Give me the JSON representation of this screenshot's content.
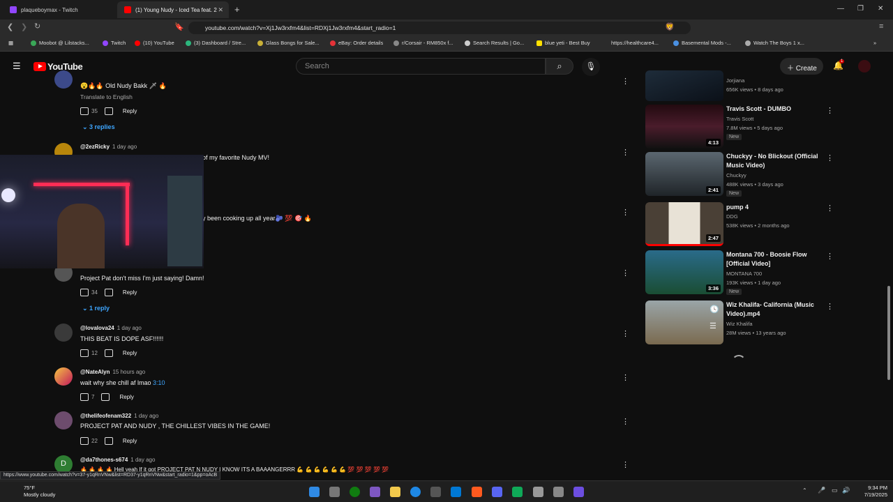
{
  "browser": {
    "tabs": [
      {
        "title": "plaqueboymax - Twitch"
      },
      {
        "title": "(1) Young Nudy - Iced Tea feat. 2"
      }
    ],
    "url": "youtube.com/watch?v=Xj1Jw3rxfm4&list=RDXj1Jw3rxfm4&start_radio=1",
    "bookmarks": [
      "Moobot @ Lilstacks...",
      "Twitch",
      "(10) YouTube",
      "(3) Dashboard / Stre...",
      "Glass Bongs for Sale...",
      "eBay: Order details",
      "r/Corsair - RM850x f...",
      "Search Results | Go...",
      "blue yeti - Best Buy",
      "https://healthcare4...",
      "Basemental Mods -...",
      "Watch The Boys 1 x..."
    ]
  },
  "youtube": {
    "logo": "YouTube",
    "search_placeholder": "Search",
    "create_label": "Create",
    "notif_count": "1"
  },
  "comments": [
    {
      "user": "",
      "date": "",
      "text": "😮🔥🔥 Old Nudy Bakk 🗡 🔥",
      "translate": "Translate to English",
      "likes": "35",
      "replies": "3 replies",
      "reply": "Reply"
    },
    {
      "user": "@2ezRicky",
      "date": "1 day ago",
      "text": "of my favorite Nudy MV!"
    },
    {
      "text": "y been cooking up all year🫐 💯 🎯 🔥"
    },
    {
      "text": "Project Pat don't miss I'm just saying! Damn!",
      "likes": "34",
      "reply": "Reply",
      "replies": "1 reply"
    },
    {
      "user": "@lovalova24",
      "date": "1 day ago",
      "text": "THIS BEAT IS DOPE ASF!!!!!!",
      "likes": "12",
      "reply": "Reply"
    },
    {
      "user": "@NateAlyn",
      "date": "15 hours ago",
      "text": "wait why she chill af lmao ",
      "link": "3:10",
      "likes": "7",
      "reply": "Reply"
    },
    {
      "user": "@thelifeofenam322",
      "date": "1 day ago",
      "text": "PROJECT PAT AND NUDY , THE CHILLEST VIBES IN THE GAME!",
      "likes": "22",
      "reply": "Reply"
    },
    {
      "user": "@da7thones-s674",
      "date": "1 day ago",
      "text": "🔥 🔥 🔥 🔥 Hell yeah If it got PROJECT PAT N NUDY I KNOW ITS A BAAANGERRR 💪 💪 💪 💪 💪 💪 💯 💯 💯 💯 💯"
    }
  ],
  "sidebar": [
    {
      "title": "",
      "channel": "Jorjiana",
      "meta": "656K views • 8 days ago"
    },
    {
      "title": "Travis Scott - DUMBO",
      "channel": "Travis Scott",
      "meta": "7.8M views • 5 days ago",
      "badge": "New",
      "duration": "4:13"
    },
    {
      "title": "Chuckyy - No Blickout (Official Music Video)",
      "channel": "Chuckyy",
      "meta": "488K views • 3 days ago",
      "badge": "New",
      "duration": "2:41"
    },
    {
      "title": "pump 4",
      "channel": "DDG",
      "meta": "538K views • 2 months ago",
      "duration": "2:47"
    },
    {
      "title": "Montana 700 - Boosie Flow [Official Video]",
      "channel": "MONTANA 700",
      "meta": "193K views • 1 day ago",
      "badge": "New",
      "duration": "3:36"
    },
    {
      "title": "Wiz Khalifa- California (Music Video).mp4",
      "channel": "Wiz Khalifa",
      "meta": "28M views • 13 years ago"
    }
  ],
  "status_url": "https://www.youtube.com/watch?v=37-y1qRnVNw&list=RD37-y1qRnVNw&start_radio=1&pp=oAcB",
  "taskbar": {
    "temp": "75°F",
    "weather": "Mostly cloudy",
    "time": "9:34 PM",
    "date": "7/19/2025"
  },
  "colors": {
    "accent": "#ff0000",
    "link": "#3ea6ff",
    "bg": "#0f0f0f"
  }
}
